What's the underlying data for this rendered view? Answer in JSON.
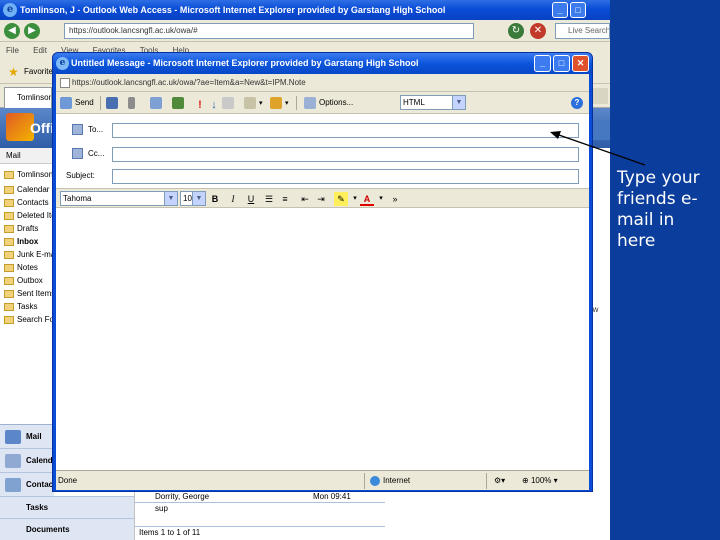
{
  "browser": {
    "title": "Tomlinson, J - Outlook Web Access - Microsoft Internet Explorer provided by Garstang High School",
    "url": "https://outlook.lancsngfl.ac.uk/owa/#",
    "search_placeholder": "Live Search",
    "menu": [
      "File",
      "Edit",
      "View",
      "Favorites",
      "Tools",
      "Help"
    ],
    "favorites_label": "Favorites",
    "tab_label": "Tomlinson"
  },
  "owa": {
    "product": "Office",
    "mail_header": "Mail",
    "folders": [
      "Tomlinson",
      "Calendar",
      "Contacts",
      "Deleted Items",
      "Drafts",
      "Inbox",
      "Junk E-mail",
      "Notes",
      "Outbox",
      "Sent Items",
      "Tasks",
      "Search Folders"
    ],
    "nav_buttons": [
      "Mail",
      "Calendar",
      "Contacts",
      "Tasks",
      "Documents"
    ],
    "right_fragment": "n w",
    "list": {
      "sender": "Dorrity, George",
      "time": "Mon 09:41",
      "subject": "sup",
      "paging": "Items 1 to 1 of 11"
    }
  },
  "compose": {
    "title": "Untitled Message - Microsoft Internet Explorer provided by Garstang High School",
    "url": "https://outlook.lancsngfl.ac.uk/owa/?ae=Item&a=New&t=IPM.Note",
    "toolbar": {
      "send": "Send",
      "options": "Options...",
      "format": "HTML"
    },
    "fields": {
      "to_label": "To...",
      "cc_label": "Cc...",
      "subject_label": "Subject:"
    },
    "formatting": {
      "font": "Tahoma",
      "size": "10",
      "bold": "B",
      "italic": "I",
      "underline": "U"
    },
    "status": {
      "left": "Done",
      "zone": "Internet",
      "zoom": "100%"
    }
  },
  "annotation": {
    "text": "Type your friends e-mail in here"
  },
  "colors": {
    "xp_title": "#0a4cd6",
    "annotation_bg": "#0b3d9c",
    "toolbar_bg": "#ece9d8"
  }
}
